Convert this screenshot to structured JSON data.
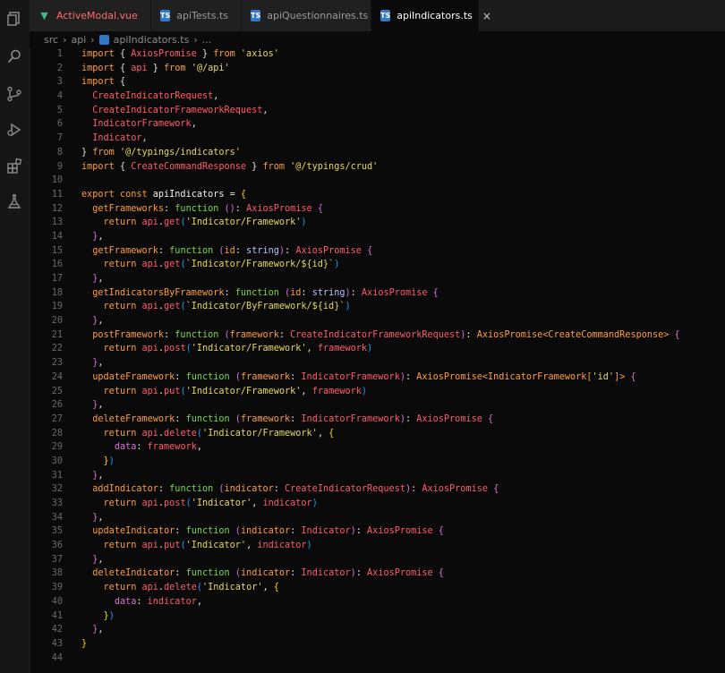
{
  "colors": {
    "background": "#0a0a0a",
    "tab_active": "#0a0a0a",
    "keyword": "#ff9d3a",
    "type": "#ff5a6a",
    "function": "#7ad94a",
    "string": "#e7d95f"
  },
  "activity_bar": {
    "icons": [
      "files-icon",
      "search-icon",
      "source-control-icon",
      "run-debug-icon",
      "extensions-icon",
      "testing-icon"
    ]
  },
  "tabs": [
    {
      "label": "ActiveModal.vue",
      "icon": "vue-file-icon",
      "color": "#ff6b6b",
      "active": false
    },
    {
      "label": "apiTests.ts",
      "icon": "ts-file-icon",
      "color": "#9a9a9a",
      "active": false
    },
    {
      "label": "apiQuestionnaires.ts",
      "icon": "ts-file-icon",
      "color": "#9a9a9a",
      "active": false
    },
    {
      "label": "apiIndicators.ts",
      "icon": "ts-file-icon",
      "color": "#ffffff",
      "active": true,
      "close": "×"
    }
  ],
  "breadcrumb": {
    "parts": [
      "src",
      "api"
    ],
    "file": "apiIndicators.ts",
    "trail": "..."
  },
  "code_lines": [
    [
      [
        "import",
        "kw"
      ],
      [
        " { ",
        "p"
      ],
      [
        "AxiosPromise",
        "type"
      ],
      [
        " } ",
        "p"
      ],
      [
        "from",
        "kw"
      ],
      [
        " ",
        "p"
      ],
      [
        "'axios'",
        "str"
      ]
    ],
    [
      [
        "import",
        "kw"
      ],
      [
        " { ",
        "p"
      ],
      [
        "api",
        "type"
      ],
      [
        " } ",
        "p"
      ],
      [
        "from",
        "kw"
      ],
      [
        " ",
        "p"
      ],
      [
        "'@/api'",
        "str"
      ]
    ],
    [
      [
        "import",
        "kw"
      ],
      [
        " {",
        "p"
      ]
    ],
    [
      [
        "  ",
        "p"
      ],
      [
        "CreateIndicatorRequest",
        "type"
      ],
      [
        ",",
        "p"
      ]
    ],
    [
      [
        "  ",
        "p"
      ],
      [
        "CreateIndicatorFrameworkRequest",
        "type"
      ],
      [
        ",",
        "p"
      ]
    ],
    [
      [
        "  ",
        "p"
      ],
      [
        "IndicatorFramework",
        "type"
      ],
      [
        ",",
        "p"
      ]
    ],
    [
      [
        "  ",
        "p"
      ],
      [
        "Indicator",
        "type"
      ],
      [
        ",",
        "p"
      ]
    ],
    [
      [
        "} ",
        "p"
      ],
      [
        "from",
        "kw"
      ],
      [
        " ",
        "p"
      ],
      [
        "'@/typings/indicators'",
        "str"
      ]
    ],
    [
      [
        "import",
        "kw"
      ],
      [
        " { ",
        "p"
      ],
      [
        "CreateCommandResponse",
        "type"
      ],
      [
        " } ",
        "p"
      ],
      [
        "from",
        "kw"
      ],
      [
        " ",
        "p"
      ],
      [
        "'@/typings/crud'",
        "str"
      ]
    ],
    [],
    [
      [
        "export",
        "kw"
      ],
      [
        " ",
        "p"
      ],
      [
        "const",
        "kw"
      ],
      [
        " ",
        "p"
      ],
      [
        "apiIndicators",
        "id"
      ],
      [
        " = ",
        "p"
      ],
      [
        "{",
        "b1"
      ]
    ],
    [
      [
        "  ",
        "p"
      ],
      [
        "getFrameworks",
        "fn"
      ],
      [
        ": ",
        "p"
      ],
      [
        "function",
        "func"
      ],
      [
        " ",
        "p"
      ],
      [
        "()",
        "b2"
      ],
      [
        ": ",
        "p"
      ],
      [
        "AxiosPromise",
        "type"
      ],
      [
        " ",
        "p"
      ],
      [
        "{",
        "b2"
      ]
    ],
    [
      [
        "    ",
        "p"
      ],
      [
        "return",
        "kw"
      ],
      [
        " ",
        "p"
      ],
      [
        "api",
        "type"
      ],
      [
        ".",
        "p"
      ],
      [
        "get",
        "type"
      ],
      [
        "(",
        "b3"
      ],
      [
        "'Indicator/Framework'",
        "str"
      ],
      [
        ")",
        "b3"
      ]
    ],
    [
      [
        "  ",
        "p"
      ],
      [
        "}",
        "b2"
      ],
      [
        ",",
        "p"
      ]
    ],
    [
      [
        "  ",
        "p"
      ],
      [
        "getFramework",
        "fn"
      ],
      [
        ": ",
        "p"
      ],
      [
        "function",
        "func"
      ],
      [
        " ",
        "p"
      ],
      [
        "(",
        "b2"
      ],
      [
        "id",
        "param"
      ],
      [
        ": ",
        "p"
      ],
      [
        "string",
        "tp"
      ],
      [
        ")",
        "b2"
      ],
      [
        ": ",
        "p"
      ],
      [
        "AxiosPromise",
        "type"
      ],
      [
        " ",
        "p"
      ],
      [
        "{",
        "b2"
      ]
    ],
    [
      [
        "    ",
        "p"
      ],
      [
        "return",
        "kw"
      ],
      [
        " ",
        "p"
      ],
      [
        "api",
        "type"
      ],
      [
        ".",
        "p"
      ],
      [
        "get",
        "type"
      ],
      [
        "(",
        "b3"
      ],
      [
        "`Indicator/Framework/${id}`",
        "str"
      ],
      [
        ")",
        "b3"
      ]
    ],
    [
      [
        "  ",
        "p"
      ],
      [
        "}",
        "b2"
      ],
      [
        ",",
        "p"
      ]
    ],
    [
      [
        "  ",
        "p"
      ],
      [
        "getIndicatorsByFramework",
        "fn"
      ],
      [
        ": ",
        "p"
      ],
      [
        "function",
        "func"
      ],
      [
        " ",
        "p"
      ],
      [
        "(",
        "b2"
      ],
      [
        "id",
        "param"
      ],
      [
        ": ",
        "p"
      ],
      [
        "string",
        "tp"
      ],
      [
        ")",
        "b2"
      ],
      [
        ": ",
        "p"
      ],
      [
        "AxiosPromise",
        "type"
      ],
      [
        " ",
        "p"
      ],
      [
        "{",
        "b2"
      ]
    ],
    [
      [
        "    ",
        "p"
      ],
      [
        "return",
        "kw"
      ],
      [
        " ",
        "p"
      ],
      [
        "api",
        "type"
      ],
      [
        ".",
        "p"
      ],
      [
        "get",
        "type"
      ],
      [
        "(",
        "b3"
      ],
      [
        "`Indicator/ByFramework/${id}`",
        "str"
      ],
      [
        ")",
        "b3"
      ]
    ],
    [
      [
        "  ",
        "p"
      ],
      [
        "}",
        "b2"
      ],
      [
        ",",
        "p"
      ]
    ],
    [
      [
        "  ",
        "p"
      ],
      [
        "postFramework",
        "fn"
      ],
      [
        ": ",
        "p"
      ],
      [
        "function",
        "func"
      ],
      [
        " ",
        "p"
      ],
      [
        "(",
        "b2"
      ],
      [
        "framework",
        "param"
      ],
      [
        ": ",
        "p"
      ],
      [
        "CreateIndicatorFrameworkRequest",
        "type"
      ],
      [
        ")",
        "b2"
      ],
      [
        ": ",
        "p"
      ],
      [
        "AxiosPromise<CreateCommandResponse>",
        "gen"
      ],
      [
        " ",
        "p"
      ],
      [
        "{",
        "b2"
      ]
    ],
    [
      [
        "    ",
        "p"
      ],
      [
        "return",
        "kw"
      ],
      [
        " ",
        "p"
      ],
      [
        "api",
        "type"
      ],
      [
        ".",
        "p"
      ],
      [
        "post",
        "type"
      ],
      [
        "(",
        "b3"
      ],
      [
        "'Indicator/Framework'",
        "str"
      ],
      [
        ", ",
        "p"
      ],
      [
        "framework",
        "type"
      ],
      [
        ")",
        "b3"
      ]
    ],
    [
      [
        "  ",
        "p"
      ],
      [
        "}",
        "b2"
      ],
      [
        ",",
        "p"
      ]
    ],
    [
      [
        "  ",
        "p"
      ],
      [
        "updateFramework",
        "fn"
      ],
      [
        ": ",
        "p"
      ],
      [
        "function",
        "func"
      ],
      [
        " ",
        "p"
      ],
      [
        "(",
        "b2"
      ],
      [
        "framework",
        "param"
      ],
      [
        ": ",
        "p"
      ],
      [
        "IndicatorFramework",
        "type"
      ],
      [
        ")",
        "b2"
      ],
      [
        ": ",
        "p"
      ],
      [
        "AxiosPromise<IndicatorFramework[",
        "gen"
      ],
      [
        "'id'",
        "str"
      ],
      [
        "]>",
        "gen"
      ],
      [
        " ",
        "p"
      ],
      [
        "{",
        "b2"
      ]
    ],
    [
      [
        "    ",
        "p"
      ],
      [
        "return",
        "kw"
      ],
      [
        " ",
        "p"
      ],
      [
        "api",
        "type"
      ],
      [
        ".",
        "p"
      ],
      [
        "put",
        "type"
      ],
      [
        "(",
        "b3"
      ],
      [
        "'Indicator/Framework'",
        "str"
      ],
      [
        ", ",
        "p"
      ],
      [
        "framework",
        "type"
      ],
      [
        ")",
        "b3"
      ]
    ],
    [
      [
        "  ",
        "p"
      ],
      [
        "}",
        "b2"
      ],
      [
        ",",
        "p"
      ]
    ],
    [
      [
        "  ",
        "p"
      ],
      [
        "deleteFramework",
        "fn"
      ],
      [
        ": ",
        "p"
      ],
      [
        "function",
        "func"
      ],
      [
        " ",
        "p"
      ],
      [
        "(",
        "b2"
      ],
      [
        "framework",
        "param"
      ],
      [
        ": ",
        "p"
      ],
      [
        "IndicatorFramework",
        "type"
      ],
      [
        ")",
        "b2"
      ],
      [
        ": ",
        "p"
      ],
      [
        "AxiosPromise",
        "type"
      ],
      [
        " ",
        "p"
      ],
      [
        "{",
        "b2"
      ]
    ],
    [
      [
        "    ",
        "p"
      ],
      [
        "return",
        "kw"
      ],
      [
        " ",
        "p"
      ],
      [
        "api",
        "type"
      ],
      [
        ".",
        "p"
      ],
      [
        "delete",
        "type"
      ],
      [
        "(",
        "b3"
      ],
      [
        "'Indicator/Framework'",
        "str"
      ],
      [
        ", ",
        "p"
      ],
      [
        "{",
        "b1"
      ]
    ],
    [
      [
        "      ",
        "p"
      ],
      [
        "data",
        "b2"
      ],
      [
        ": ",
        "p"
      ],
      [
        "framework",
        "type"
      ],
      [
        ",",
        "p"
      ]
    ],
    [
      [
        "    ",
        "p"
      ],
      [
        "}",
        "b1"
      ],
      [
        ")",
        "b3"
      ]
    ],
    [
      [
        "  ",
        "p"
      ],
      [
        "}",
        "b2"
      ],
      [
        ",",
        "p"
      ]
    ],
    [
      [
        "  ",
        "p"
      ],
      [
        "addIndicator",
        "fn"
      ],
      [
        ": ",
        "p"
      ],
      [
        "function",
        "func"
      ],
      [
        " ",
        "p"
      ],
      [
        "(",
        "b2"
      ],
      [
        "indicator",
        "param"
      ],
      [
        ": ",
        "p"
      ],
      [
        "CreateIndicatorRequest",
        "type"
      ],
      [
        ")",
        "b2"
      ],
      [
        ": ",
        "p"
      ],
      [
        "AxiosPromise",
        "type"
      ],
      [
        " ",
        "p"
      ],
      [
        "{",
        "b2"
      ]
    ],
    [
      [
        "    ",
        "p"
      ],
      [
        "return",
        "kw"
      ],
      [
        " ",
        "p"
      ],
      [
        "api",
        "type"
      ],
      [
        ".",
        "p"
      ],
      [
        "post",
        "type"
      ],
      [
        "(",
        "b3"
      ],
      [
        "'Indicator'",
        "str"
      ],
      [
        ", ",
        "p"
      ],
      [
        "indicator",
        "type"
      ],
      [
        ")",
        "b3"
      ]
    ],
    [
      [
        "  ",
        "p"
      ],
      [
        "}",
        "b2"
      ],
      [
        ",",
        "p"
      ]
    ],
    [
      [
        "  ",
        "p"
      ],
      [
        "updateIndicator",
        "fn"
      ],
      [
        ": ",
        "p"
      ],
      [
        "function",
        "func"
      ],
      [
        " ",
        "p"
      ],
      [
        "(",
        "b2"
      ],
      [
        "indicator",
        "param"
      ],
      [
        ": ",
        "p"
      ],
      [
        "Indicator",
        "type"
      ],
      [
        ")",
        "b2"
      ],
      [
        ": ",
        "p"
      ],
      [
        "AxiosPromise",
        "type"
      ],
      [
        " ",
        "p"
      ],
      [
        "{",
        "b2"
      ]
    ],
    [
      [
        "    ",
        "p"
      ],
      [
        "return",
        "kw"
      ],
      [
        " ",
        "p"
      ],
      [
        "api",
        "type"
      ],
      [
        ".",
        "p"
      ],
      [
        "put",
        "type"
      ],
      [
        "(",
        "b3"
      ],
      [
        "'Indicator'",
        "str"
      ],
      [
        ", ",
        "p"
      ],
      [
        "indicator",
        "type"
      ],
      [
        ")",
        "b3"
      ]
    ],
    [
      [
        "  ",
        "p"
      ],
      [
        "}",
        "b2"
      ],
      [
        ",",
        "p"
      ]
    ],
    [
      [
        "  ",
        "p"
      ],
      [
        "deleteIndicator",
        "fn"
      ],
      [
        ": ",
        "p"
      ],
      [
        "function",
        "func"
      ],
      [
        " ",
        "p"
      ],
      [
        "(",
        "b2"
      ],
      [
        "indicator",
        "param"
      ],
      [
        ": ",
        "p"
      ],
      [
        "Indicator",
        "type"
      ],
      [
        ")",
        "b2"
      ],
      [
        ": ",
        "p"
      ],
      [
        "AxiosPromise",
        "type"
      ],
      [
        " ",
        "p"
      ],
      [
        "{",
        "b2"
      ]
    ],
    [
      [
        "    ",
        "p"
      ],
      [
        "return",
        "kw"
      ],
      [
        " ",
        "p"
      ],
      [
        "api",
        "type"
      ],
      [
        ".",
        "p"
      ],
      [
        "delete",
        "type"
      ],
      [
        "(",
        "b3"
      ],
      [
        "'Indicator'",
        "str"
      ],
      [
        ", ",
        "p"
      ],
      [
        "{",
        "b1"
      ]
    ],
    [
      [
        "      ",
        "p"
      ],
      [
        "data",
        "b2"
      ],
      [
        ": ",
        "p"
      ],
      [
        "indicator",
        "type"
      ],
      [
        ",",
        "p"
      ]
    ],
    [
      [
        "    ",
        "p"
      ],
      [
        "}",
        "b1"
      ],
      [
        ")",
        "b3"
      ]
    ],
    [
      [
        "  ",
        "p"
      ],
      [
        "}",
        "b2"
      ],
      [
        ",",
        "p"
      ]
    ],
    [
      [
        "}",
        "b1"
      ]
    ],
    []
  ]
}
